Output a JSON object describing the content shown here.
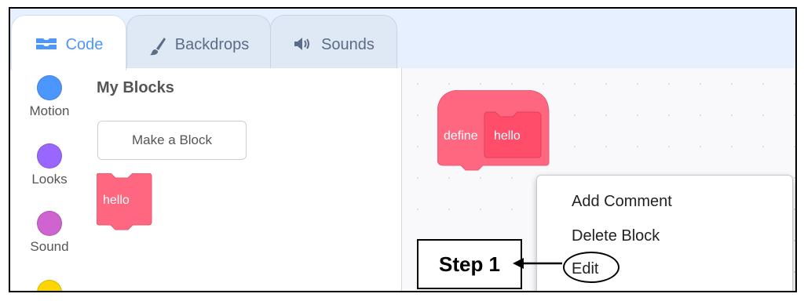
{
  "tabs": [
    {
      "label": "Code",
      "icon": "code-icon",
      "active": true
    },
    {
      "label": "Backdrops",
      "icon": "paintbrush-icon",
      "active": false
    },
    {
      "label": "Sounds",
      "icon": "speaker-icon",
      "active": false
    }
  ],
  "categories": [
    {
      "label": "Motion",
      "color": "#4c97ff"
    },
    {
      "label": "Looks",
      "color": "#9966ff"
    },
    {
      "label": "Sound",
      "color": "#cf63cf"
    },
    {
      "label": "",
      "color": "#ffd500"
    }
  ],
  "palette": {
    "heading": "My Blocks",
    "make_block_label": "Make a Block",
    "hello_block_label": "hello"
  },
  "workspace": {
    "define_label": "define",
    "define_name": "hello",
    "block_color": "#ff6680"
  },
  "context_menu": {
    "items": [
      "Add Comment",
      "Delete Block",
      "Edit"
    ]
  },
  "annotation": {
    "step_label": "Step 1"
  }
}
